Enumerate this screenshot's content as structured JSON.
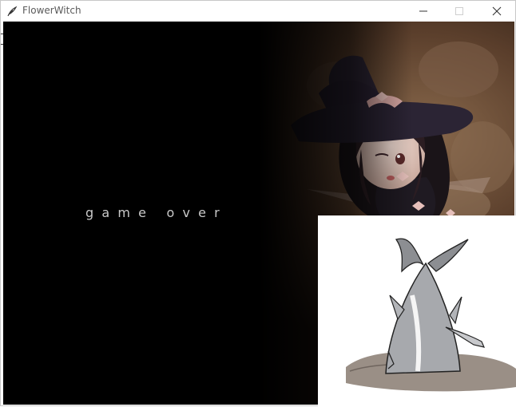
{
  "window": {
    "title": "FlowerWitch",
    "icon": "quill-icon",
    "controls": [
      "minimize-icon",
      "maximize-icon",
      "close-icon"
    ]
  },
  "game": {
    "message": "game over",
    "message_color": "#c9c9c9",
    "background_color": "#000000"
  },
  "overlay": {
    "description_icon": "shark-in-sand-icon"
  }
}
